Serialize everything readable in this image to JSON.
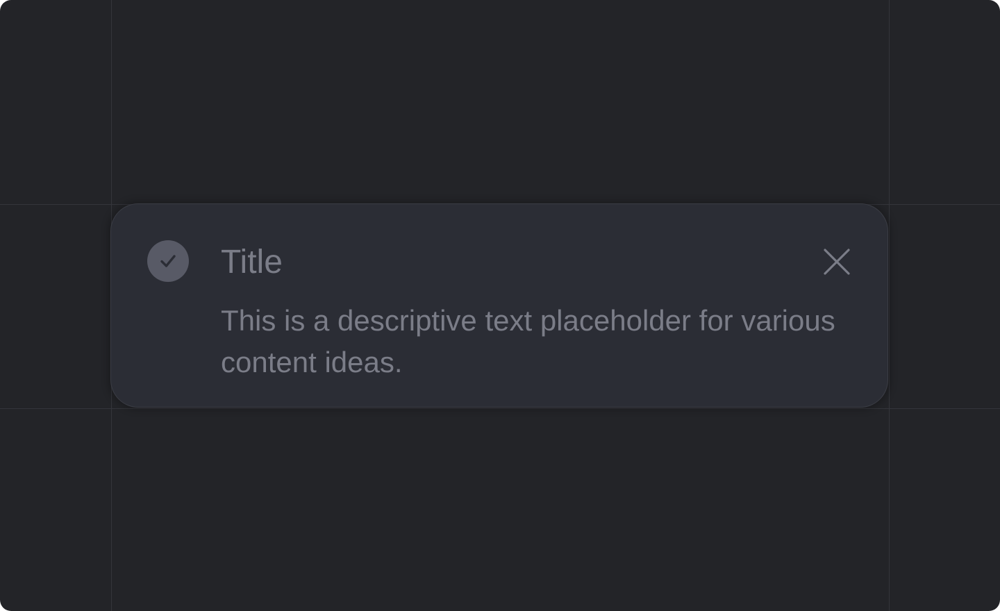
{
  "toast": {
    "title": "Title",
    "description": "This is a descriptive text placeholder for various content ideas.",
    "status_icon": "check-circle-icon",
    "close_icon": "close-icon"
  },
  "colors": {
    "background": "#232428",
    "toast_background": "#2b2d35",
    "text": "#7b7d88",
    "icon_circle": "#585a66",
    "icon_glyph": "#2b2d35",
    "guide_lines": "#34353b"
  }
}
